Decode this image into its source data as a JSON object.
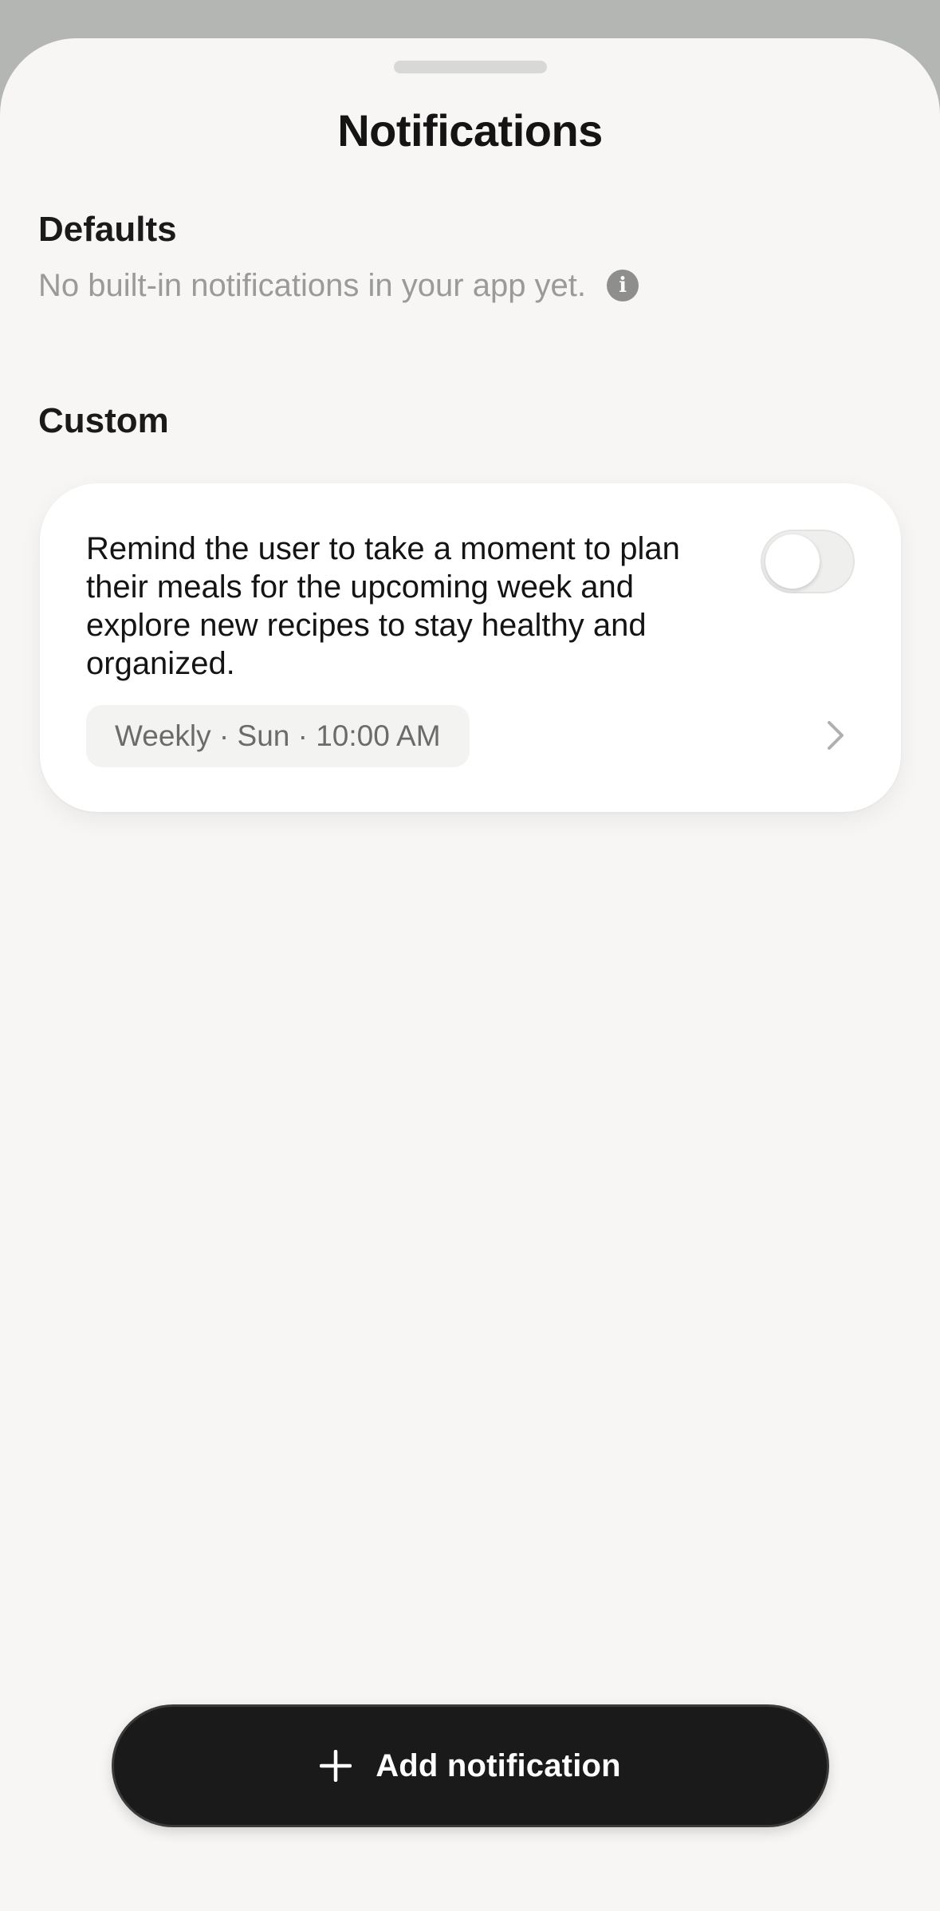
{
  "sheet": {
    "title": "Notifications"
  },
  "defaults": {
    "heading": "Defaults",
    "description": "No built-in notifications in your app yet.",
    "info_icon": "info-icon"
  },
  "custom": {
    "heading": "Custom",
    "items": [
      {
        "text": "Remind the user to take a moment to plan their meals for the upcoming week and explore new recipes to stay healthy and organized.",
        "schedule": "Weekly · Sun · 10:00 AM",
        "enabled": false
      }
    ]
  },
  "add_button": {
    "label": "Add notification",
    "icon": "plus-icon"
  },
  "colors": {
    "background": "#f7f6f4",
    "card": "#ffffff",
    "button": "#1a1a1a",
    "muted_text": "#9a9a98"
  }
}
